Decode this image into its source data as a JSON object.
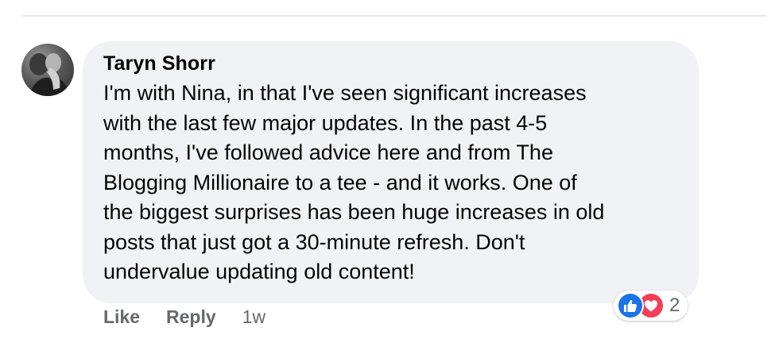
{
  "comment": {
    "author": "Taryn Shorr",
    "text": "I'm with Nina, in that I've seen significant increases\nwith the last few major updates. In the past 4-5\nmonths, I've followed advice here and from The\nBlogging Millionaire to a tee - and it works. One of\nthe biggest surprises has been huge increases in old\nposts that just got a 30-minute refresh. Don't\nundervalue updating old content!",
    "reactions": {
      "icons": [
        "like-icon",
        "love-icon"
      ],
      "count": "2",
      "like_color": "#1b74e4",
      "love_color": "#f33e58"
    },
    "actions": {
      "like_label": "Like",
      "reply_label": "Reply",
      "timestamp": "1w"
    }
  },
  "colors": {
    "bubble_background": "#f0f2f5",
    "secondary_text": "#65676b",
    "primary_text": "#050505"
  }
}
